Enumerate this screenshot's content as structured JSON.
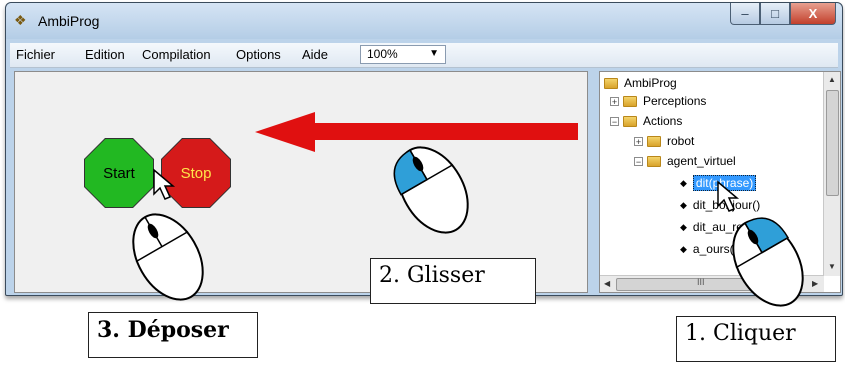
{
  "window": {
    "title": "AmbiProg"
  },
  "window_buttons": {
    "minimize": "–",
    "maximize": "□",
    "close": "X"
  },
  "menu": {
    "items": [
      "Fichier",
      "Edition",
      "Compilation",
      "Options",
      "Aide"
    ]
  },
  "zoom": {
    "value": "100%"
  },
  "canvas": {
    "blocks": [
      "Start",
      "Stop"
    ]
  },
  "tree": {
    "root": "AmbiProg",
    "items": [
      "Perceptions",
      "Actions",
      "robot",
      "agent_virtuel",
      "dit(phrase)",
      "dit_bonjour()",
      "dit_au_revoir()",
      "a_ours(num"
    ],
    "scroll_mark": "III"
  },
  "labels": {
    "step1": "1. Cliquer",
    "step2": "2. Glisser",
    "step3": "3. Déposer"
  },
  "colors": {
    "arrow": "#e01010",
    "start": "#22b822",
    "stop": "#d51a1a",
    "mouse_button": "#2f9fd8"
  }
}
